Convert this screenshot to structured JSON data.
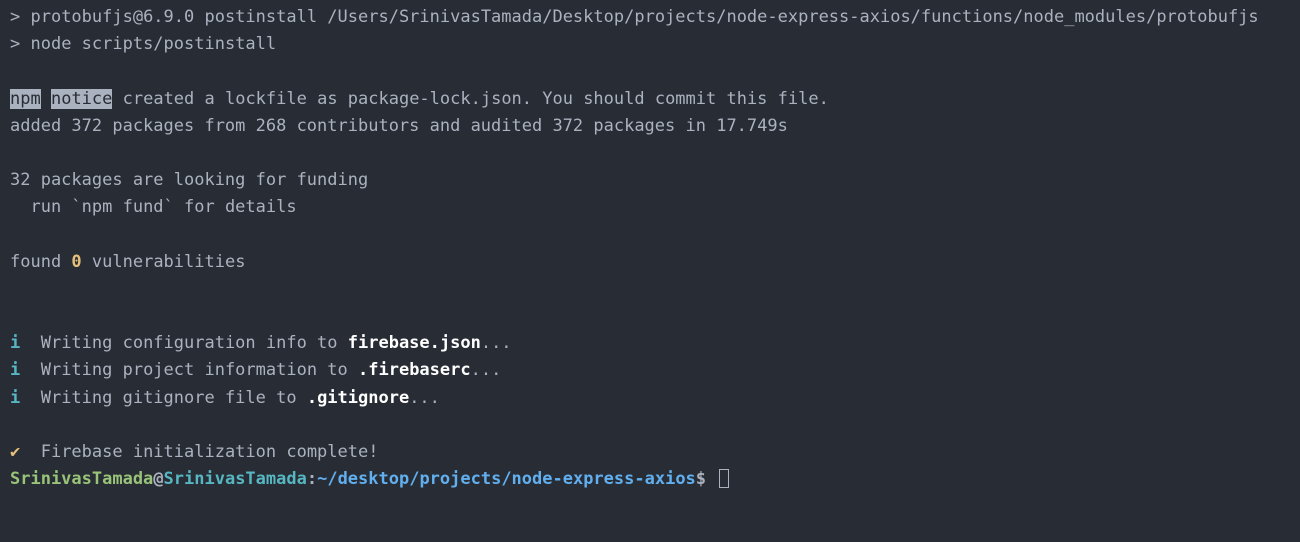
{
  "line1_prefix": "> ",
  "line1_package": "protobufjs@6.9.0 postinstall",
  "line1_path": " /Users/SrinivasTamada/Desktop/projects/node-express-axios/functions/node_modules/protobufjs",
  "line2_prefix": "> ",
  "line2_cmd": "node scripts/postinstall",
  "npm_label": "npm",
  "notice_label": "notice",
  "lockfile_msg": " created a lockfile as package-lock.json. You should commit this file.",
  "added_msg": "added 372 packages from 268 contributors and audited 372 packages in 17.749s",
  "funding_msg1": "32 packages are looking for funding",
  "funding_msg2": "  run `npm fund` for details",
  "found_prefix": "found ",
  "found_count": "0",
  "found_suffix": " vulnerabilities",
  "info_symbol": "i",
  "write1_prefix": "  Writing configuration info to ",
  "write1_file": "firebase.json",
  "write1_suffix": "...",
  "write2_prefix": "  Writing project information to ",
  "write2_file": ".firebaserc",
  "write2_suffix": "...",
  "write3_prefix": "  Writing gitignore file to ",
  "write3_file": ".gitignore",
  "write3_suffix": "...",
  "check_symbol": "✔",
  "complete_msg": "  Firebase initialization complete!",
  "prompt_user": "SrinivasTamada",
  "prompt_at": "@",
  "prompt_host": "SrinivasTamada",
  "prompt_colon": ":",
  "prompt_path": "~/desktop/projects/node-express-axios",
  "prompt_dollar": "$ "
}
